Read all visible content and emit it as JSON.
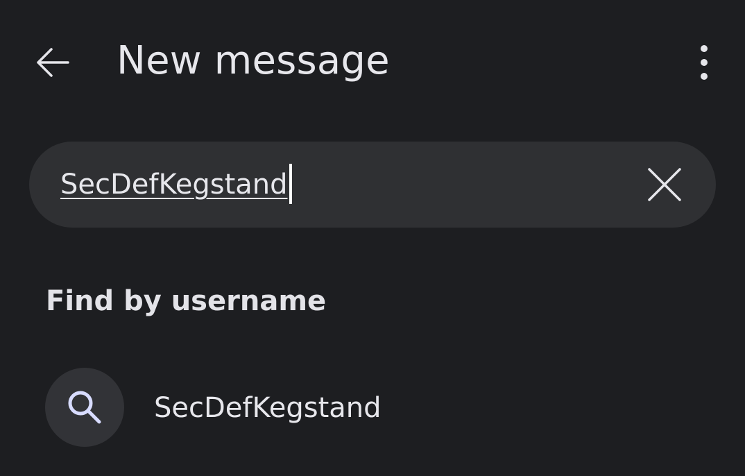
{
  "header": {
    "title": "New message",
    "back_icon": "arrow-left-icon",
    "menu_icon": "more-vertical-icon"
  },
  "search": {
    "value": "SecDefKegstand",
    "clear_icon": "close-icon"
  },
  "section": {
    "label": "Find by username"
  },
  "results": [
    {
      "icon": "search-icon",
      "label": "SecDefKegstand"
    }
  ],
  "colors": {
    "background": "#1d1e21",
    "search_bar": "#2f3033",
    "avatar_bg": "#323337",
    "text": "#e7e7ec",
    "icon_accent": "#d8dcff"
  }
}
